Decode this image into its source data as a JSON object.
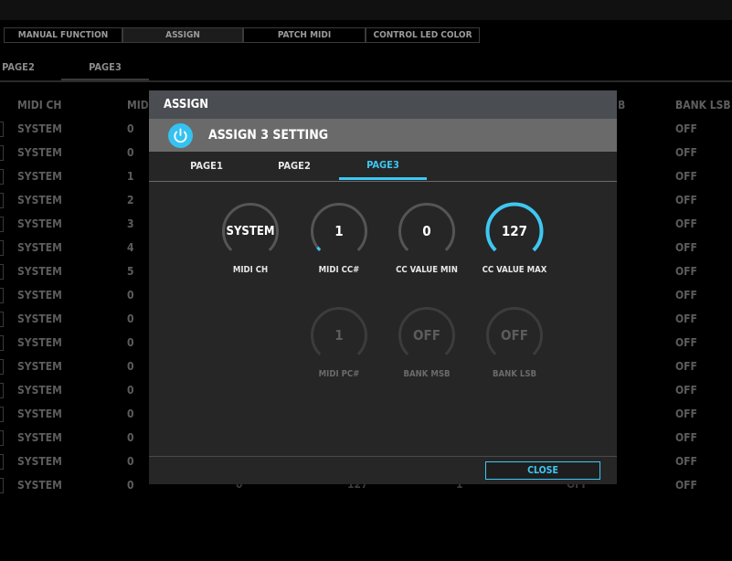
{
  "main_tabs": [
    {
      "label": "MANUAL FUNCTION"
    },
    {
      "label": "ASSIGN"
    },
    {
      "label": "PATCH MIDI"
    },
    {
      "label": "CONTROL LED COLOR"
    }
  ],
  "page_tabs": [
    {
      "label": "PAGE2"
    },
    {
      "label": "PAGE3"
    }
  ],
  "columns": {
    "midi_ch": "MIDI CH",
    "midi_cc_partial": "MID",
    "bank_lsb": "BANK LSB",
    "hidden_header": "B"
  },
  "rows": [
    {
      "midi_ch": "SYSTEM",
      "cc": "0",
      "bank_lsb": "OFF"
    },
    {
      "midi_ch": "SYSTEM",
      "cc": "0",
      "bank_lsb": "OFF"
    },
    {
      "midi_ch": "SYSTEM",
      "cc": "1",
      "bank_lsb": "OFF"
    },
    {
      "midi_ch": "SYSTEM",
      "cc": "2",
      "bank_lsb": "OFF"
    },
    {
      "midi_ch": "SYSTEM",
      "cc": "3",
      "bank_lsb": "OFF"
    },
    {
      "midi_ch": "SYSTEM",
      "cc": "4",
      "bank_lsb": "OFF"
    },
    {
      "midi_ch": "SYSTEM",
      "cc": "5",
      "bank_lsb": "OFF"
    },
    {
      "midi_ch": "SYSTEM",
      "cc": "0",
      "bank_lsb": "OFF"
    },
    {
      "midi_ch": "SYSTEM",
      "cc": "0",
      "bank_lsb": "OFF"
    },
    {
      "midi_ch": "SYSTEM",
      "cc": "0",
      "bank_lsb": "OFF"
    },
    {
      "midi_ch": "SYSTEM",
      "cc": "0",
      "bank_lsb": "OFF"
    },
    {
      "midi_ch": "SYSTEM",
      "cc": "0",
      "bank_lsb": "OFF"
    },
    {
      "midi_ch": "SYSTEM",
      "cc": "0",
      "bank_lsb": "OFF"
    },
    {
      "midi_ch": "SYSTEM",
      "cc": "0",
      "bank_lsb": "OFF"
    },
    {
      "midi_ch": "SYSTEM",
      "cc": "0",
      "bank_lsb": "OFF"
    },
    {
      "midi_ch": "SYSTEM",
      "cc": "0",
      "bank_lsb": "OFF"
    }
  ],
  "last_row_hidden_values": [
    "0",
    "127",
    "1",
    "OFF"
  ],
  "dialog": {
    "title": "ASSIGN",
    "subtitle": "ASSIGN 3 SETTING",
    "power_icon": "power-icon",
    "tabs": [
      {
        "label": "PAGE1"
      },
      {
        "label": "PAGE2"
      },
      {
        "label": "PAGE3"
      }
    ],
    "active_tab": "PAGE3",
    "knobs": [
      {
        "value": "SYSTEM",
        "label": "MIDI CH",
        "enabled": true,
        "level": 0.0
      },
      {
        "value": "1",
        "label": "MIDI CC#",
        "enabled": true,
        "level": 0.01
      },
      {
        "value": "0",
        "label": "CC VALUE MIN",
        "enabled": true,
        "level": 0.0
      },
      {
        "value": "127",
        "label": "CC VALUE MAX",
        "enabled": true,
        "level": 1.0
      },
      {
        "value": "1",
        "label": "MIDI PC#",
        "enabled": false,
        "level": 0.0
      },
      {
        "value": "OFF",
        "label": "BANK MSB",
        "enabled": false,
        "level": 0.0
      },
      {
        "value": "OFF",
        "label": "BANK LSB",
        "enabled": false,
        "level": 0.0
      }
    ],
    "close_label": "CLOSE"
  },
  "colors": {
    "accent": "#3ec7f3",
    "background": "#000000",
    "dialog": "#262626",
    "title_bar": "#4a4d52",
    "subtitle_bar": "#6a6a6a"
  }
}
